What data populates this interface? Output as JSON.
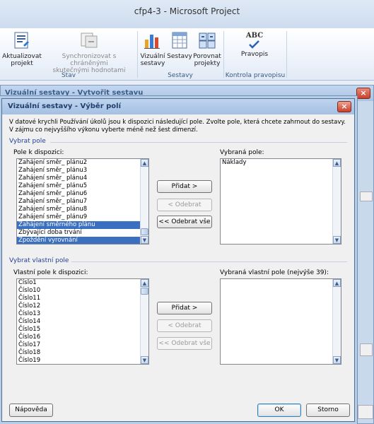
{
  "app": {
    "title": "cfp4-3  -  Microsoft Project"
  },
  "ribbon": {
    "update_project": "Aktualizovat\nprojekt",
    "sync_line1": "Synchronizovat s chráněnými",
    "sync_line2": "skutečnými hodnotami",
    "group_stav": "Stav",
    "visual_reports": "Vizuální\nsestavy",
    "reports": "Sestavy",
    "compare_projects": "Porovnat\nprojekty",
    "group_sestavy": "Sestavy",
    "spelling": "Pravopis",
    "group_kontrola": "Kontrola pravopisu",
    "spelling_icon_text": "ABC"
  },
  "bg_window": {
    "title": "Vizuální sestavy - Vytvořit sestavu",
    "close": "×"
  },
  "dialog": {
    "title": "Vizuální sestavy - Výběr polí",
    "close": "×",
    "intro": "V datové krychli Používání úkolů jsou k dispozici následující pole. Zvolte pole, která chcete zahrnout do sestavy. V zájmu co nejvyššího výkonu vyberte méně než šest dimenzí.",
    "section1": "Vybrat pole",
    "available_label": "Pole k dispozici:",
    "available_items": [
      "Zahájení směr_ plánu2",
      "Zahájení směr_ plánu3",
      "Zahájení směr_ plánu4",
      "Zahájení směr_ plánu5",
      "Zahájení směr_ plánu6",
      "Zahájení směr_ plánu7",
      "Zahájení směr_ plánu8",
      "Zahájení směr_ plánu9",
      "Zahájení směrného plánu",
      "Zbývající doba trvání",
      "Zpoždění vyrovnání"
    ],
    "selected_label": "Vybraná pole:",
    "selected_items": [
      "Náklady"
    ],
    "add": "Přidat >",
    "remove": "< Odebrat",
    "remove_all": "<< Odebrat vše",
    "section2": "Vybrat vlastní pole",
    "custom_available_label": "Vlastní pole k dispozici:",
    "custom_items": [
      "Číslo1",
      "Číslo10",
      "Číslo11",
      "Číslo12",
      "Číslo13",
      "Číslo14",
      "Číslo15",
      "Číslo16",
      "Číslo17",
      "Číslo18",
      "Číslo19"
    ],
    "custom_selected_label": "Vybraná vlastní pole (nejvýše 39):",
    "add2": "Přidat >",
    "remove2": "< Odebrat",
    "remove_all2": "<< Odebrat vše",
    "help": "Nápověda",
    "ok": "OK",
    "cancel": "Storno"
  }
}
